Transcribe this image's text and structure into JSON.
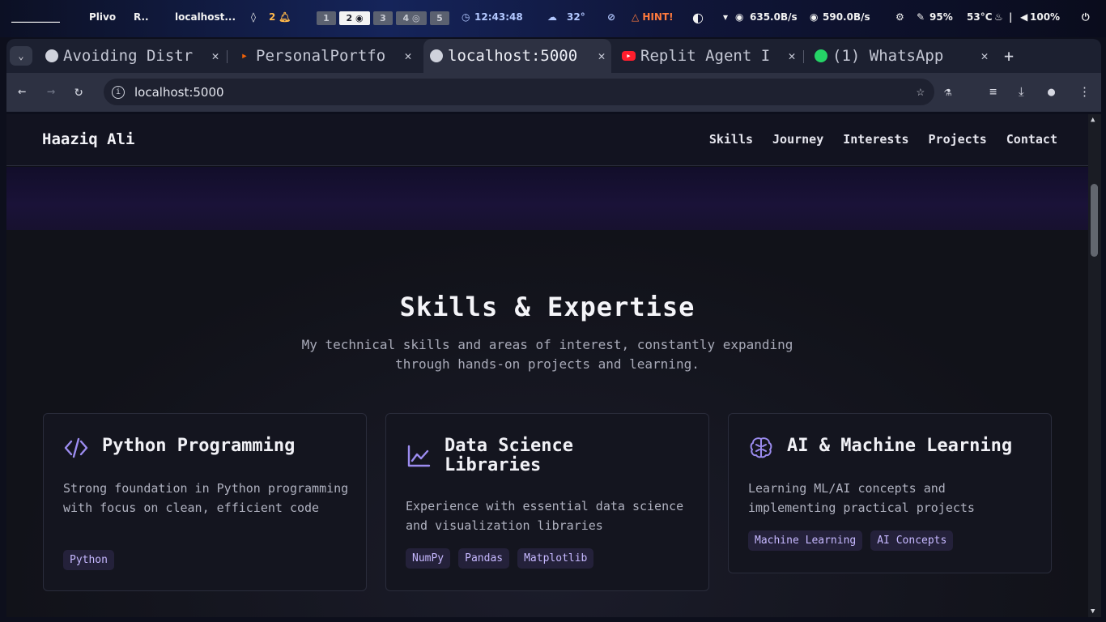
{
  "system_bar": {
    "workspace_label": "__________",
    "app1": "Plivo",
    "app2": "R..",
    "active_window": "localhost...",
    "notifications": "2",
    "workspaces": [
      "1",
      "2",
      "3",
      "4",
      "5"
    ],
    "time": "12:43:48",
    "weather": "32°",
    "hint": "HINT!",
    "download_speed": "635.0B/s",
    "upload_speed": "590.0B/s",
    "brightness": "95%",
    "temperature": "53°C",
    "volume": "100%"
  },
  "browser": {
    "tabs": [
      {
        "title": "Avoiding Distr",
        "favicon_color": "#cfd2dc"
      },
      {
        "title": "PersonalPortfo",
        "favicon_color": "#f26207"
      },
      {
        "title": "localhost:5000",
        "favicon_color": "#cfd2dc"
      },
      {
        "title": "Replit Agent I",
        "favicon_color": "#ff1e2d"
      },
      {
        "title": "(1) WhatsApp",
        "favicon_color": "#25d366"
      }
    ],
    "url": "localhost:5000"
  },
  "site": {
    "brand": "Haaziq Ali",
    "nav": [
      "Skills",
      "Journey",
      "Interests",
      "Projects",
      "Contact"
    ],
    "skills": {
      "title": "Skills & Expertise",
      "subtitle": "My technical skills and areas of interest, constantly expanding through hands-on projects and learning.",
      "cards": [
        {
          "icon": "code-icon",
          "title": "Python Programming",
          "description": "Strong foundation in Python programming with focus on clean, efficient code",
          "tags": [
            "Python"
          ]
        },
        {
          "icon": "chart-line-icon",
          "title": "Data Science Libraries",
          "description": "Experience with essential data science and visualization libraries",
          "tags": [
            "NumPy",
            "Pandas",
            "Matplotlib"
          ]
        },
        {
          "icon": "brain-icon",
          "title": "AI & Machine Learning",
          "description": "Learning ML/AI concepts and implementing practical projects",
          "tags": [
            "Machine Learning",
            "AI Concepts"
          ]
        }
      ]
    }
  },
  "colors": {
    "accent": "#9c8cf0",
    "tag_text": "#c6b8ff",
    "page_bg": "#111219"
  }
}
